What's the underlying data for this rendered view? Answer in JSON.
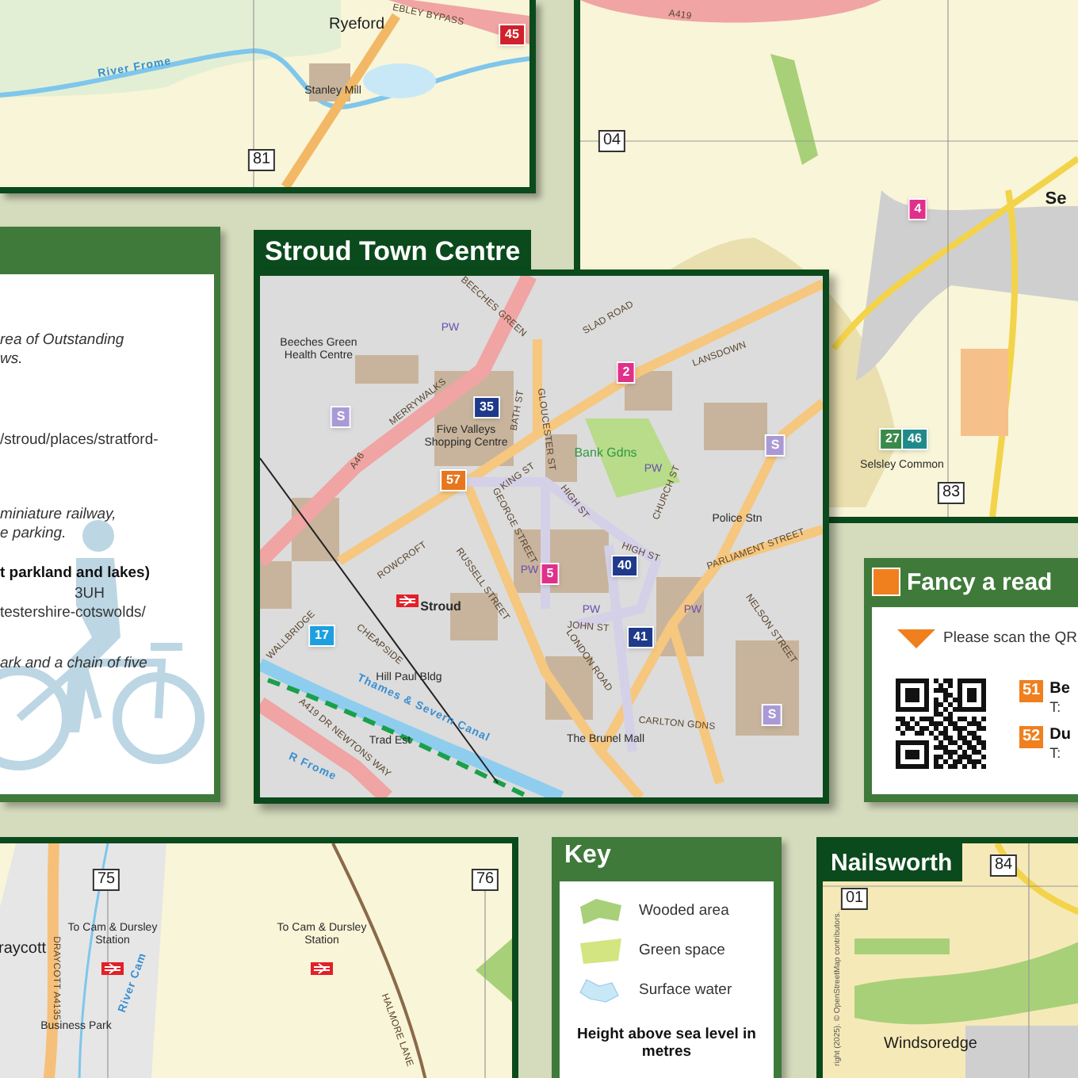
{
  "top_left_map": {
    "labels": [
      {
        "text": "EBLEY BYPASS",
        "kind": "road"
      },
      {
        "text": "45",
        "kind": "badge",
        "color": "#d0202a"
      },
      {
        "text": "Ryeford",
        "kind": "place"
      },
      {
        "text": "River Frome",
        "kind": "water"
      },
      {
        "text": "Stanley Mill",
        "kind": "small"
      },
      {
        "text": "81",
        "kind": "grid"
      }
    ]
  },
  "top_right_map": {
    "labels": [
      {
        "text": "A419",
        "kind": "road"
      },
      {
        "text": "04",
        "kind": "grid"
      },
      {
        "text": "4",
        "kind": "badge",
        "color": "#e0308a"
      },
      {
        "text": "Se",
        "kind": "town"
      },
      {
        "text": "27",
        "kind": "badge",
        "color": "#3a8a4a"
      },
      {
        "text": "46",
        "kind": "badge",
        "color": "#1f8a8a"
      },
      {
        "text": "Selsley Common",
        "kind": "small"
      },
      {
        "text": "83",
        "kind": "grid"
      }
    ]
  },
  "info_panel": {
    "lines": [
      {
        "text": "rea of Outstanding",
        "kind": "italic"
      },
      {
        "text": "ws.",
        "kind": "italic"
      },
      {
        "text": "/stroud/places/stratford-",
        "kind": "plain"
      },
      {
        "text": "miniature railway,",
        "kind": "italic"
      },
      {
        "text": "e parking.",
        "kind": "italic"
      },
      {
        "text": "t parkland and lakes)",
        "kind": "bold"
      },
      {
        "text": "3UH",
        "kind": "plain"
      },
      {
        "text": "testershire-cotswolds/",
        "kind": "plain"
      },
      {
        "text": "ark and a chain of five",
        "kind": "italic"
      }
    ]
  },
  "town_centre": {
    "title": "Stroud Town Centre",
    "labels": [
      {
        "text": "BEECHES GREEN",
        "kind": "road"
      },
      {
        "text": "Beeches Green Health Centre",
        "kind": "small"
      },
      {
        "text": "PW",
        "kind": "poi"
      },
      {
        "text": "MERRYWALKS",
        "kind": "road"
      },
      {
        "text": "A46",
        "kind": "road"
      },
      {
        "text": "35",
        "kind": "badge",
        "color": "#1f3a8a"
      },
      {
        "text": "Five Valleys Shopping Centre",
        "kind": "small"
      },
      {
        "text": "57",
        "kind": "badge",
        "color": "#e8761e"
      },
      {
        "text": "S",
        "kind": "badge",
        "color": "#a99ad6"
      },
      {
        "text": "SLAD ROAD",
        "kind": "road"
      },
      {
        "text": "LANSDOWN",
        "kind": "road"
      },
      {
        "text": "2",
        "kind": "badge",
        "color": "#e0308a"
      },
      {
        "text": "BATH ST",
        "kind": "road"
      },
      {
        "text": "GLOUCESTER ST",
        "kind": "road"
      },
      {
        "text": "Bank Gdns",
        "kind": "park"
      },
      {
        "text": "PW",
        "kind": "poi"
      },
      {
        "text": "S",
        "kind": "badge",
        "color": "#a99ad6"
      },
      {
        "text": "CHURCH ST",
        "kind": "road"
      },
      {
        "text": "Police Stn",
        "kind": "small"
      },
      {
        "text": "KING ST",
        "kind": "road"
      },
      {
        "text": "HIGH ST",
        "kind": "road"
      },
      {
        "text": "GEORGE STREET",
        "kind": "road"
      },
      {
        "text": "ROWCROFT",
        "kind": "road"
      },
      {
        "text": "RUSSELL STREET",
        "kind": "road"
      },
      {
        "text": "PW",
        "kind": "poi"
      },
      {
        "text": "5",
        "kind": "badge",
        "color": "#e0308a"
      },
      {
        "text": "HIGH ST",
        "kind": "road"
      },
      {
        "text": "40",
        "kind": "badge",
        "color": "#1f3a8a"
      },
      {
        "text": "PARLIAMENT STREET",
        "kind": "road"
      },
      {
        "text": "Stroud",
        "kind": "station"
      },
      {
        "text": "PW",
        "kind": "poi"
      },
      {
        "text": "JOHN ST",
        "kind": "road"
      },
      {
        "text": "PW",
        "kind": "poi"
      },
      {
        "text": "WALLBRIDGE",
        "kind": "road"
      },
      {
        "text": "17",
        "kind": "badge",
        "color": "#1ea0e0"
      },
      {
        "text": "41",
        "kind": "badge",
        "color": "#1f3a8a"
      },
      {
        "text": "CHEAPSIDE",
        "kind": "road"
      },
      {
        "text": "NELSON STREET",
        "kind": "road"
      },
      {
        "text": "LONDON ROAD",
        "kind": "road"
      },
      {
        "text": "Hill Paul Bldg",
        "kind": "small"
      },
      {
        "text": "Thames & Severn Canal",
        "kind": "water"
      },
      {
        "text": "S",
        "kind": "badge",
        "color": "#a99ad6"
      },
      {
        "text": "CARLTON GDNS",
        "kind": "road"
      },
      {
        "text": "Trad Est",
        "kind": "small"
      },
      {
        "text": "The Brunel Mall",
        "kind": "small"
      },
      {
        "text": "A419 DR NEWTONS WAY",
        "kind": "road"
      },
      {
        "text": "R Frome",
        "kind": "water"
      }
    ]
  },
  "reading_panel": {
    "title": "Fancy a read",
    "instruction": "Please scan the QR",
    "libraries": [
      {
        "number": "51",
        "name": "Be",
        "phone": "T:"
      },
      {
        "number": "52",
        "name": "Du",
        "phone": "T:"
      }
    ]
  },
  "south_map": {
    "labels": [
      {
        "text": "75",
        "kind": "grid"
      },
      {
        "text": "76",
        "kind": "grid"
      },
      {
        "text": "raycott",
        "kind": "place"
      },
      {
        "text": "To Cam & Dursley Station",
        "kind": "small"
      },
      {
        "text": "To Cam & Dursley Station",
        "kind": "small"
      },
      {
        "text": "DRAYCOTT A4135",
        "kind": "road"
      },
      {
        "text": "River Cam",
        "kind": "water"
      },
      {
        "text": "Business Park",
        "kind": "small"
      },
      {
        "text": "HALMORE LANE",
        "kind": "road"
      }
    ]
  },
  "key": {
    "title": "Key",
    "items": [
      {
        "kind": "wooded",
        "label": "Wooded area"
      },
      {
        "kind": "green",
        "label": "Green space"
      },
      {
        "kind": "water",
        "label": "Surface water"
      }
    ],
    "height_caption": "Height above sea level in metres"
  },
  "nailsworth": {
    "title": "Nailsworth",
    "labels": [
      {
        "text": "84",
        "kind": "grid"
      },
      {
        "text": "01",
        "kind": "grid"
      },
      {
        "text": "Windsoredge",
        "kind": "place"
      }
    ],
    "copyright": "right (2025). © OpenStreetMap contributors."
  }
}
